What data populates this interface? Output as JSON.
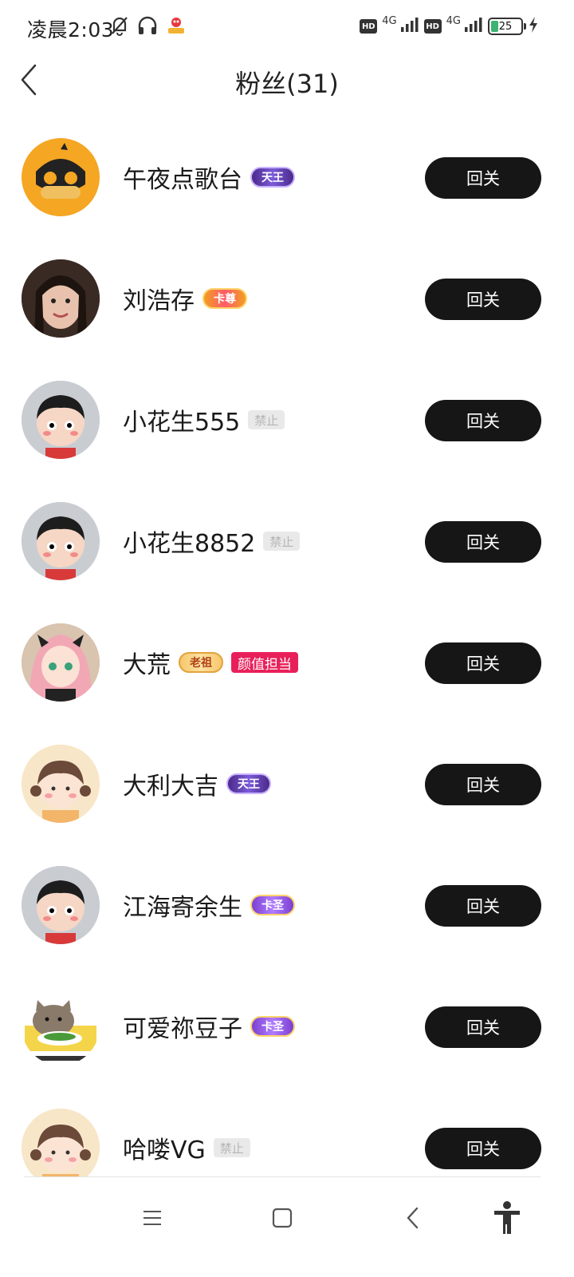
{
  "status_bar": {
    "time": "凌晨2:03",
    "network_1": "4G",
    "network_2": "4G",
    "hd_label": "HD",
    "battery_percent": "25",
    "battery_level": 0.25
  },
  "header": {
    "title": "粉丝(31)"
  },
  "followers": [
    {
      "name": "午夜点歌台",
      "badge_type": "rank",
      "badge_text": "天王",
      "badge_style": "tianwang",
      "avatar": "game-monkey",
      "button": "回关"
    },
    {
      "name": "刘浩存",
      "badge_type": "rank",
      "badge_text": "卡尊",
      "badge_style": "kazun",
      "avatar": "girl-photo",
      "button": "回关"
    },
    {
      "name": "小花生555",
      "badge_type": "ban",
      "badge_text": "禁止",
      "avatar": "cartoon-boy",
      "button": "回关"
    },
    {
      "name": "小花生8852",
      "badge_type": "ban",
      "badge_text": "禁止",
      "avatar": "cartoon-boy",
      "button": "回关"
    },
    {
      "name": "大荒",
      "badge_type": "rank",
      "badge_text": "老祖",
      "badge_style": "laozu",
      "extra_badge": "颜值担当",
      "avatar": "anime-pink-girl",
      "button": "回关"
    },
    {
      "name": "大利大吉",
      "badge_type": "rank",
      "badge_text": "天王",
      "badge_style": "tianwang",
      "avatar": "cartoon-girl",
      "button": "回关"
    },
    {
      "name": "江海寄余生",
      "badge_type": "rank",
      "badge_text": "卡圣",
      "badge_style": "kasheng",
      "avatar": "cartoon-boy",
      "button": "回关"
    },
    {
      "name": "可爱祢豆子",
      "badge_type": "rank",
      "badge_text": "卡圣",
      "badge_style": "kasheng",
      "avatar": "cat-meme",
      "button": "回关"
    },
    {
      "name": "哈喽VG",
      "badge_type": "ban",
      "badge_text": "禁止",
      "avatar": "cartoon-girl",
      "button": "回关"
    }
  ],
  "nav_bar": {
    "items": [
      "menu",
      "home",
      "back",
      "accessibility"
    ]
  }
}
